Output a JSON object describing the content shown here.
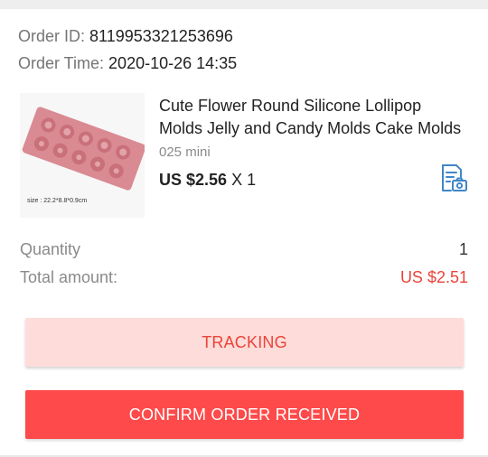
{
  "order": {
    "id_label": "Order ID:",
    "id_value": "8119953321253696",
    "time_label": "Order Time:",
    "time_value": "2020-10-26 14:35"
  },
  "product": {
    "title": "Cute Flower Round Silicone Lollipop Molds Jelly and Candy Molds Cake Molds",
    "variant": "025 mini",
    "price": "US $2.56",
    "quantity_text": "X 1",
    "image_caption": "size : 22.2*8.8*0.9cm",
    "image_icon": "pink-silicone-mold-image",
    "action_icon": "receipt-photo-icon"
  },
  "summary": {
    "quantity_label": "Quantity",
    "quantity_value": "1",
    "total_label": "Total amount:",
    "total_value": "US $2.51"
  },
  "buttons": {
    "tracking_label": "TRACKING",
    "confirm_label": "CONFIRM ORDER RECEIVED"
  },
  "colors": {
    "accent": "#e8443a",
    "confirm_bg": "#fe4a4a",
    "tracking_bg": "#fedcd9",
    "icon_blue": "#3f86c8",
    "mold_pink": "#d98a92"
  }
}
